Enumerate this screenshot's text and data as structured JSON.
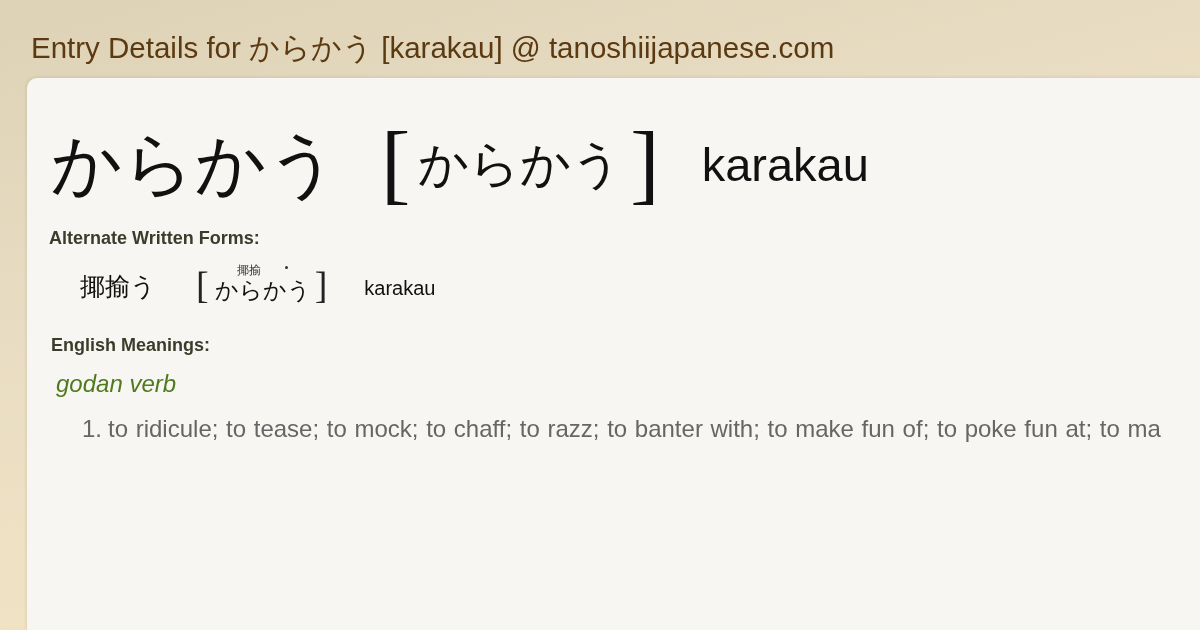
{
  "page": {
    "title": "Entry Details for からかう [karakau] @ tanoshiijapanese.com"
  },
  "entry": {
    "headword": "からかう",
    "reading": {
      "open": "[",
      "text": "からかう",
      "close": "]"
    },
    "romaji": "karakau"
  },
  "alternate_forms": {
    "heading": "Alternate Written Forms:",
    "forms": [
      {
        "written": "揶揄う",
        "reading": {
          "open": "[",
          "segments": [
            {
              "text": "か",
              "accent": false
            },
            {
              "text": "ら",
              "ruby": "揶揄",
              "accent": false
            },
            {
              "text": "か",
              "accent": false
            },
            {
              "text": "う",
              "accent": true
            }
          ],
          "close": "]"
        },
        "romaji": "karakau"
      }
    ]
  },
  "meanings": {
    "heading": "English Meanings:",
    "groups": [
      {
        "part_of_speech": "godan verb",
        "senses": [
          {
            "number": "1.",
            "text": "to ridicule; to tease; to mock; to chaff; to razz; to banter with; to make fun of; to poke fun at; to ma"
          }
        ]
      }
    ]
  }
}
